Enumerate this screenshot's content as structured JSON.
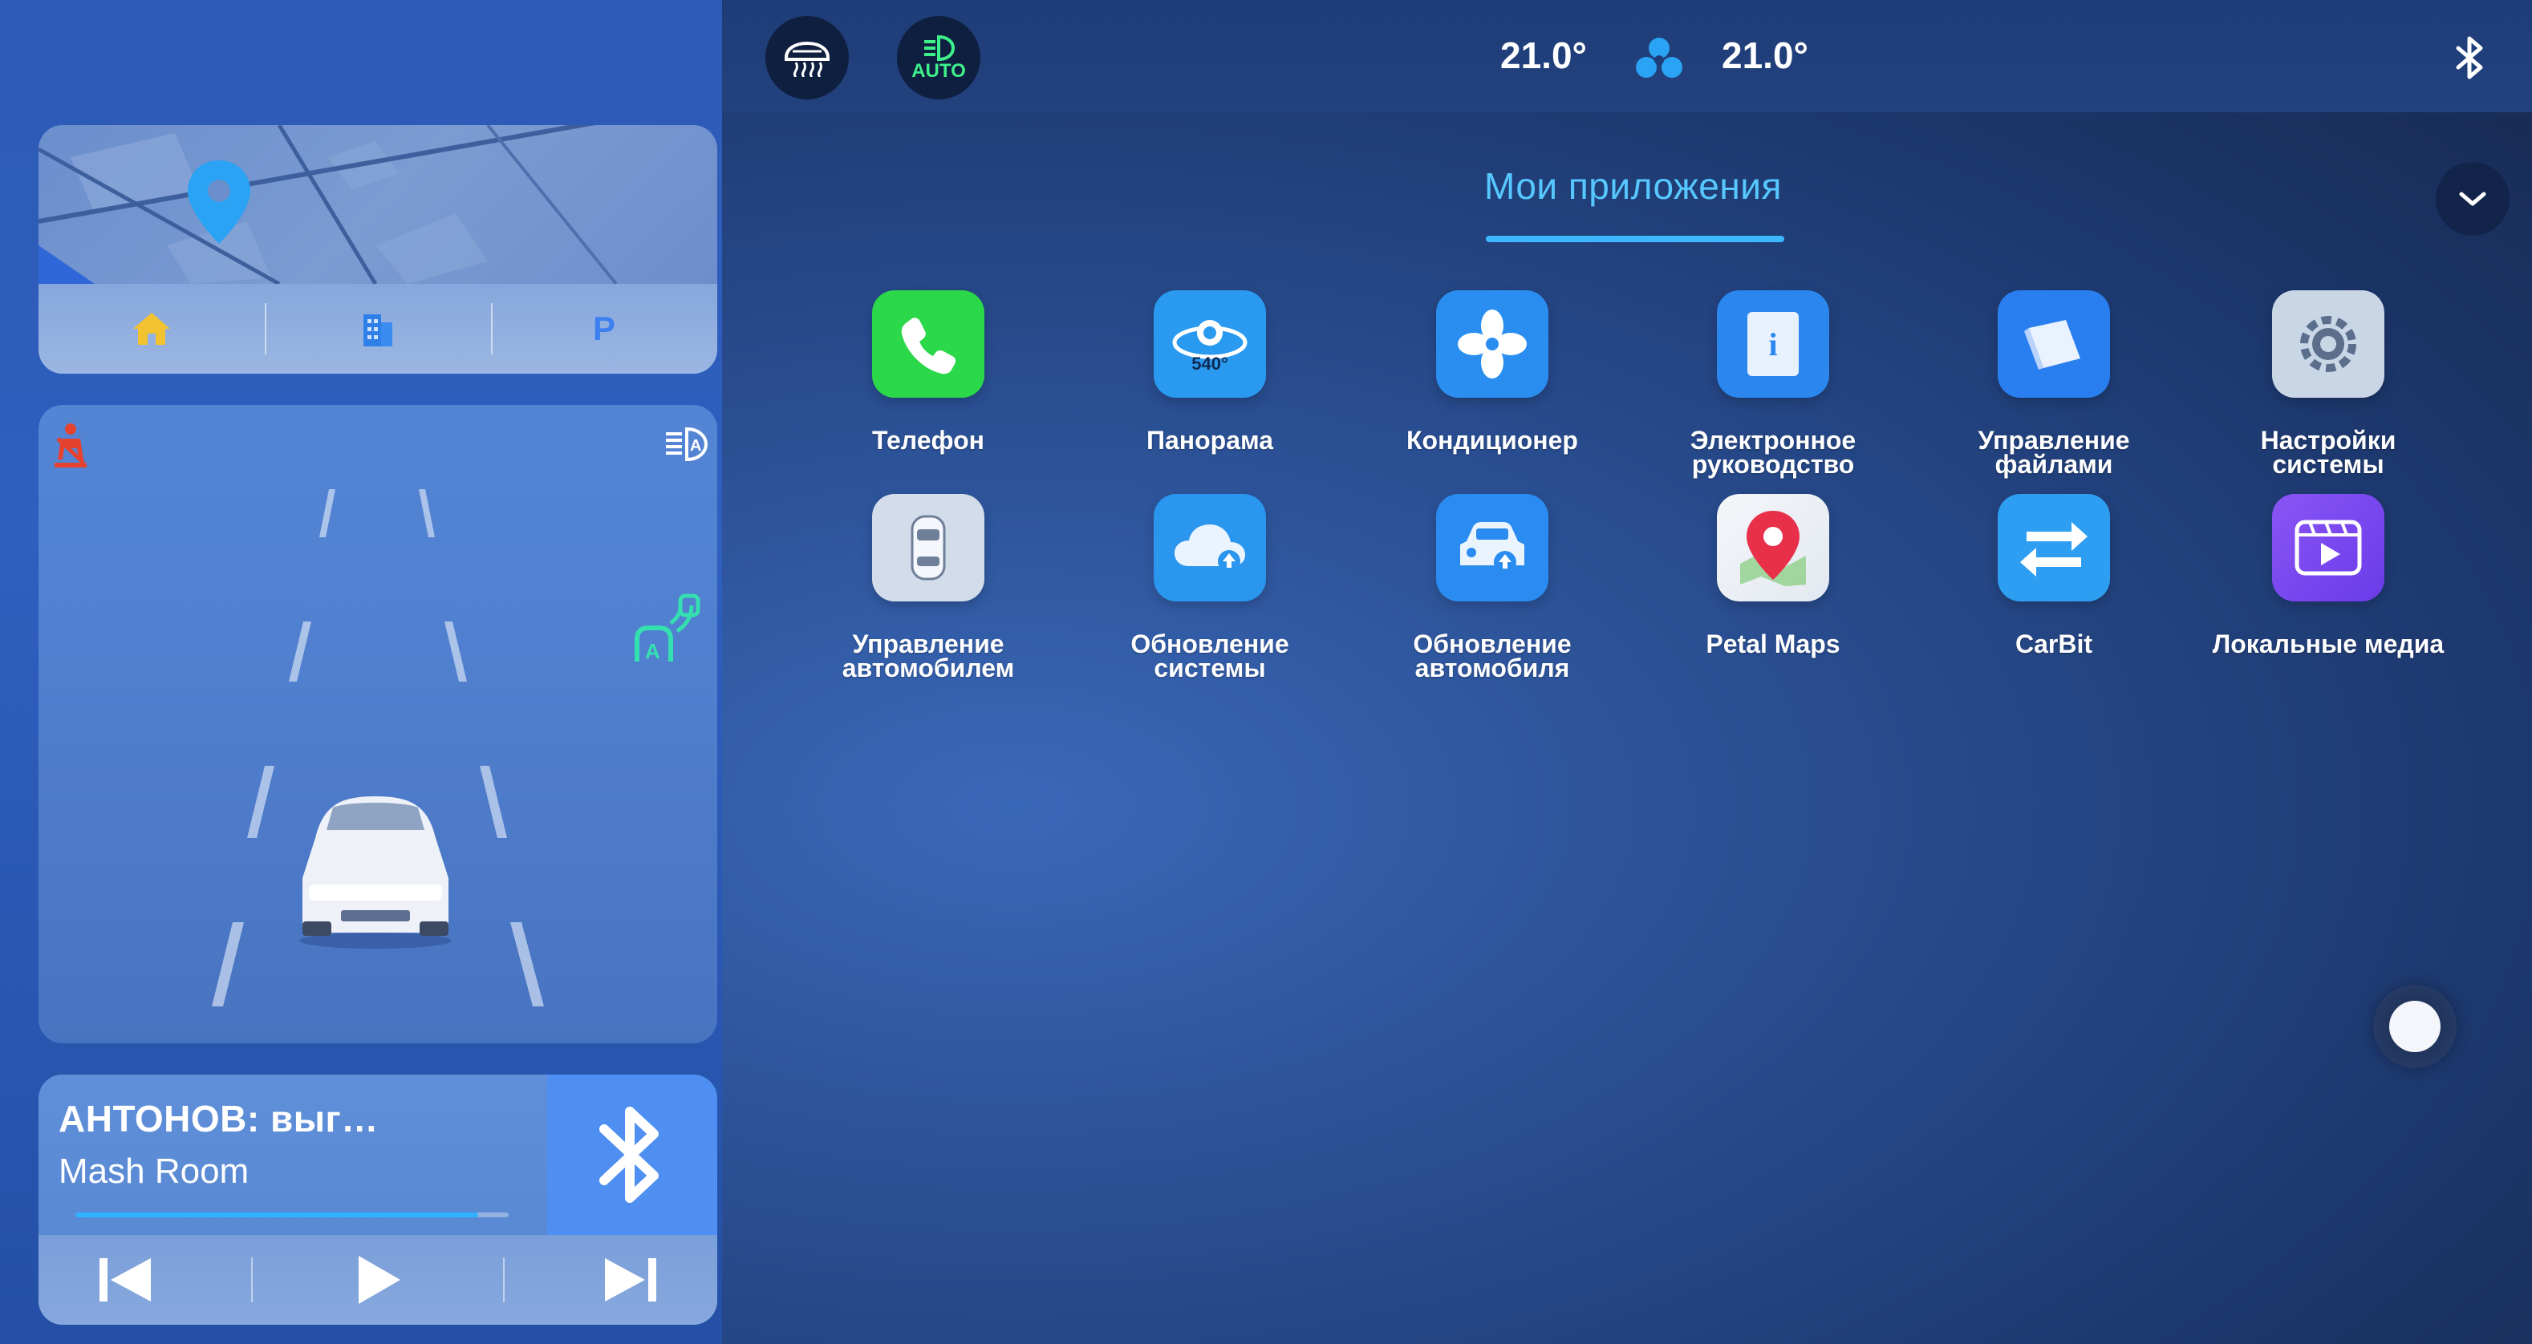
{
  "topbar": {
    "defrost_icon": "rear-defrost-icon",
    "auto_headlight_label": "AUTO",
    "temp_left": "21.0°",
    "temp_right": "21.0°",
    "fan_icon": "fan-icon",
    "bluetooth_icon": "bluetooth-icon"
  },
  "map_card": {
    "location_icon": "location-pin-icon",
    "shortcuts": [
      {
        "icon": "home-icon"
      },
      {
        "icon": "office-building-icon"
      },
      {
        "icon": "parking-icon",
        "glyph": "P"
      }
    ]
  },
  "media": {
    "title": "АНТОНОВ: выг…",
    "artist": "Mash Room",
    "progress": 0.93,
    "source_icon": "bluetooth-icon"
  },
  "apps_tab": {
    "title": "Мои приложения"
  },
  "apps": [
    {
      "label": "Телефон",
      "icon": "phone-icon",
      "bg": "#2bd84a"
    },
    {
      "label": "Панорама",
      "icon": "camera-360-icon",
      "bg": "#2a9af0",
      "badge": "540°"
    },
    {
      "label": "Кондиционер",
      "icon": "fan-icon",
      "bg": "#2a8ef0"
    },
    {
      "label": "Электронное руководство",
      "icon": "manual-book-icon",
      "bg": "#2b86ee",
      "glyph": "i"
    },
    {
      "label": "Управление файлами",
      "icon": "folder-icon",
      "bg": "#2a7ff0"
    },
    {
      "label": "Настройки системы",
      "icon": "settings-gear-icon",
      "bg": "#c9d6e6"
    },
    {
      "label": "Управление автомобилем",
      "icon": "car-top-view-icon",
      "bg": "#d2dcea"
    },
    {
      "label": "Обновление системы",
      "icon": "cloud-upload-icon",
      "bg": "#2a96ee"
    },
    {
      "label": "Обновление автомобиля",
      "icon": "car-update-icon",
      "bg": "#2a8cf0"
    },
    {
      "label": "Petal Maps",
      "icon": "map-pin-icon",
      "bg": "#f1f3f6"
    },
    {
      "label": "CarBit",
      "icon": "swap-arrows-icon",
      "bg": "#2e9ef2"
    },
    {
      "label": "Локальные медиа",
      "icon": "video-play-icon",
      "bg": "#7a4af0"
    }
  ],
  "colors": {
    "accent": "#3cb8ff",
    "phone_green": "#2bd84a"
  }
}
